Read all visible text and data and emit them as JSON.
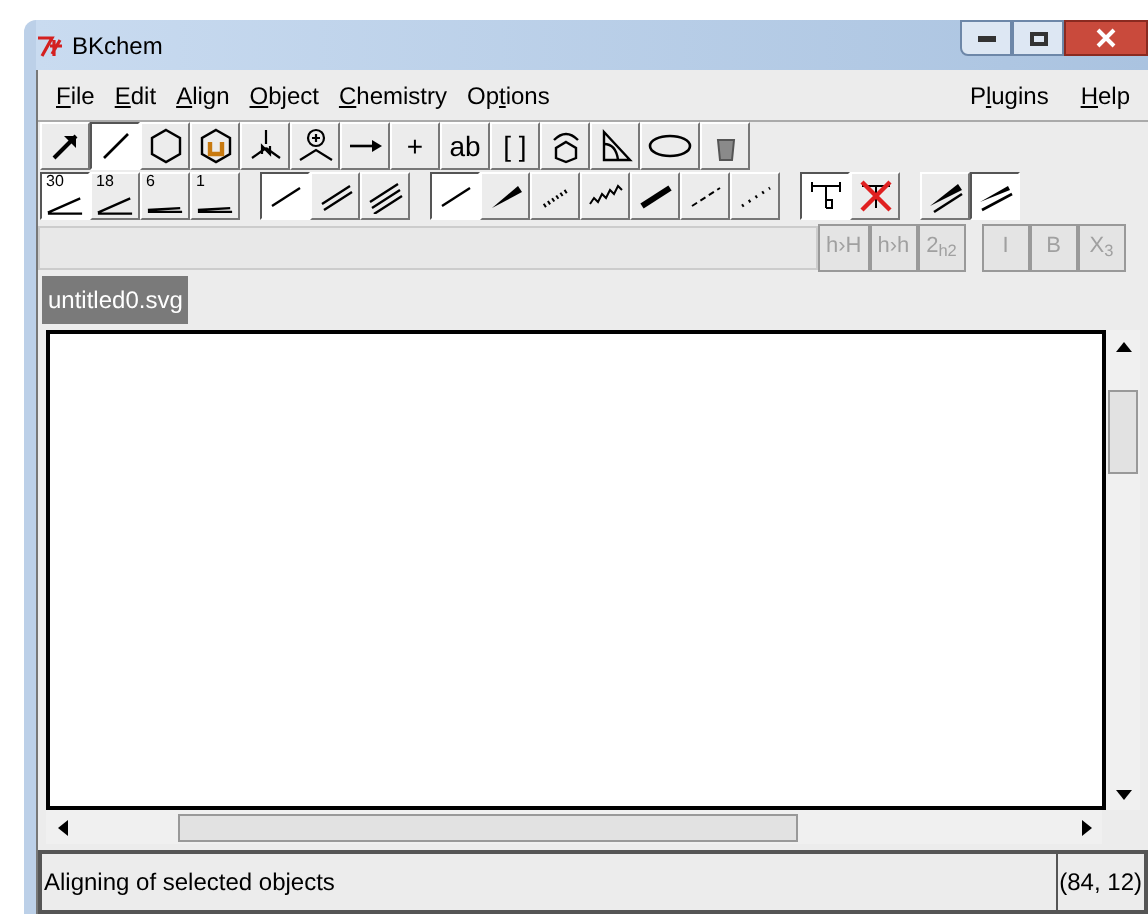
{
  "window": {
    "title": "BKchem"
  },
  "menu_left": [
    {
      "key": "F",
      "post": "ile"
    },
    {
      "key": "E",
      "post": "dit"
    },
    {
      "key": "A",
      "post": "lign"
    },
    {
      "key": "O",
      "post": "bject"
    },
    {
      "key": "C",
      "post": "hemistry"
    },
    {
      "pre": "Op",
      "key": "t",
      "post": "ions"
    }
  ],
  "menu_right": [
    {
      "pre": "P",
      "key": "l",
      "post": "ugins"
    },
    {
      "key": "H",
      "post": "elp"
    }
  ],
  "mode_tools": [
    {
      "kind": "arrow",
      "selected": false
    },
    {
      "kind": "line",
      "selected": true
    },
    {
      "kind": "ring",
      "selected": false
    },
    {
      "kind": "sugar",
      "selected": false
    },
    {
      "kind": "vsepr",
      "selected": false
    },
    {
      "kind": "charge",
      "selected": false
    },
    {
      "kind": "reaction",
      "selected": false
    },
    {
      "kind": "text",
      "label": "+",
      "selected": false
    },
    {
      "kind": "text",
      "label": "ab",
      "selected": false
    },
    {
      "kind": "text",
      "label": "[ ]",
      "selected": false
    },
    {
      "kind": "rotate",
      "selected": false
    },
    {
      "kind": "ruler",
      "selected": false
    },
    {
      "kind": "ellipse",
      "selected": false
    },
    {
      "kind": "bucket",
      "selected": false
    }
  ],
  "submode_groups": [
    [
      {
        "kind": "angle",
        "label": "30",
        "selected": true
      },
      {
        "kind": "angle",
        "label": "18",
        "selected": false
      },
      {
        "kind": "angle",
        "label": "6",
        "selected": false
      },
      {
        "kind": "angle",
        "label": "1",
        "selected": false
      }
    ],
    [
      {
        "kind": "single",
        "selected": true
      },
      {
        "kind": "double",
        "selected": false
      },
      {
        "kind": "triple",
        "selected": false
      }
    ],
    [
      {
        "kind": "single",
        "selected": true
      },
      {
        "kind": "wedge",
        "selected": false
      },
      {
        "kind": "hashed",
        "selected": false
      },
      {
        "kind": "wavy",
        "selected": false
      },
      {
        "kind": "bold",
        "selected": false
      },
      {
        "kind": "dashed",
        "selected": false
      },
      {
        "kind": "dotted",
        "selected": false
      }
    ],
    [
      {
        "kind": "fixed",
        "selected": true
      },
      {
        "kind": "nofixed",
        "selected": false
      }
    ],
    [
      {
        "kind": "wedge2",
        "selected": false
      },
      {
        "kind": "wedge3",
        "selected": true
      }
    ]
  ],
  "text_buttons": [
    [
      {
        "label": "h›H",
        "disabled": true
      },
      {
        "label": "h›h",
        "disabled": true
      },
      {
        "label": "2$_{h2}$",
        "disabled": true
      }
    ],
    [
      {
        "label": "I",
        "disabled": true
      },
      {
        "label": "B",
        "disabled": true
      },
      {
        "label": "X$_{3}$",
        "disabled": true
      }
    ]
  ],
  "tab": {
    "label": "untitled0.svg"
  },
  "status_bar": {
    "message": "Aligning of selected objects",
    "coordinates": "(84, 12)"
  }
}
